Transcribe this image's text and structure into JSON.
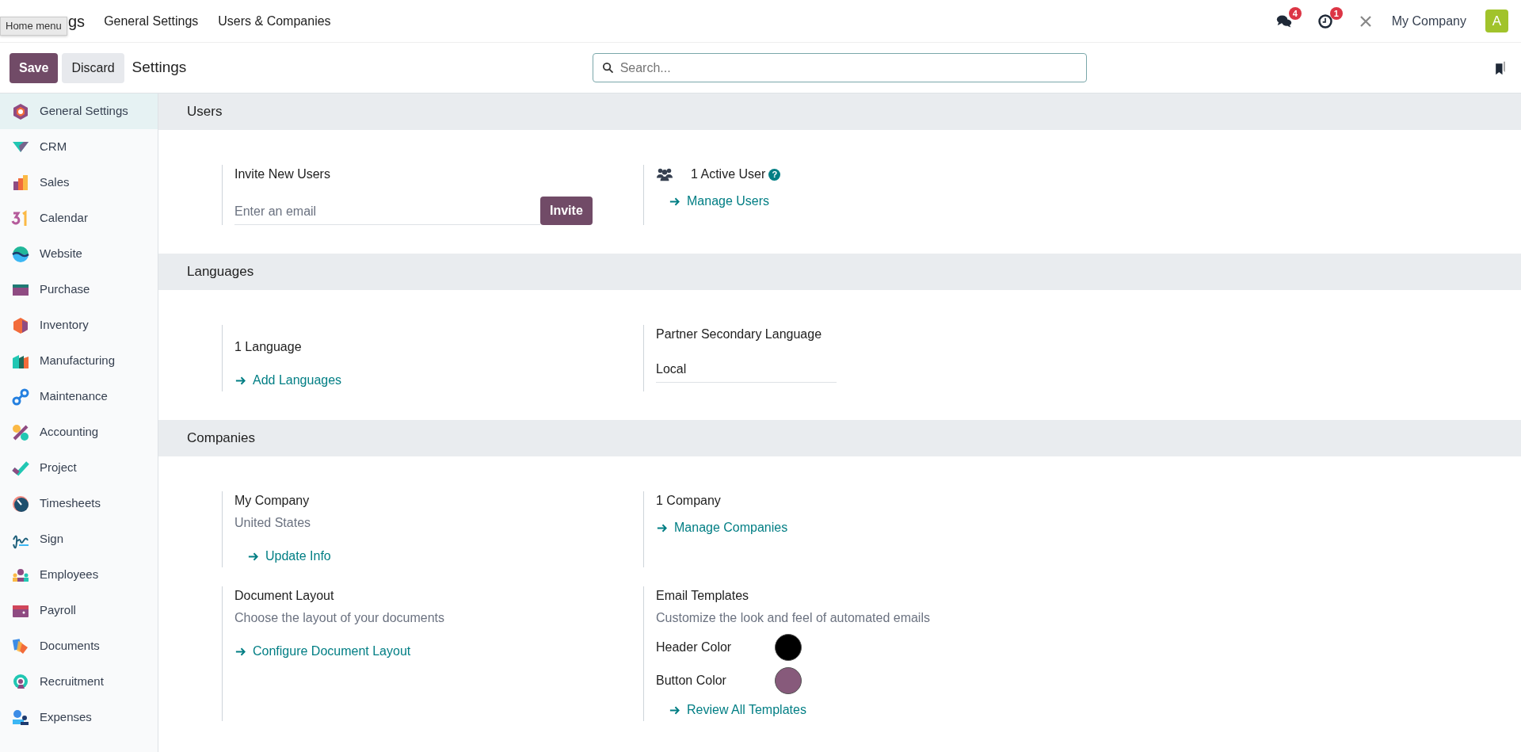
{
  "navbar": {
    "app_name": "gs",
    "tooltip": "Home menu",
    "menus": [
      "General Settings",
      "Users & Companies"
    ],
    "messages_badge": "4",
    "activities_badge": "1",
    "company": "My Company",
    "avatar": "A"
  },
  "control_panel": {
    "buttons": [
      {
        "label": "Save",
        "kind": "primary"
      },
      {
        "label": "Discard",
        "kind": "secondary"
      }
    ],
    "breadcrumb": "Settings",
    "search": {
      "placeholder": "Search..."
    }
  },
  "sidebar": {
    "items": [
      {
        "label": "General Settings",
        "selected": true
      },
      {
        "label": "CRM",
        "selected": false
      },
      {
        "label": "Sales",
        "selected": false
      },
      {
        "label": "Calendar",
        "selected": false
      },
      {
        "label": "Website",
        "selected": false
      },
      {
        "label": "Purchase",
        "selected": false
      },
      {
        "label": "Inventory",
        "selected": false
      },
      {
        "label": "Manufacturing",
        "selected": false
      },
      {
        "label": "Maintenance",
        "selected": false
      },
      {
        "label": "Accounting",
        "selected": false
      },
      {
        "label": "Project",
        "selected": false
      },
      {
        "label": "Timesheets",
        "selected": false
      },
      {
        "label": "Sign",
        "selected": false
      },
      {
        "label": "Employees",
        "selected": false
      },
      {
        "label": "Payroll",
        "selected": false
      },
      {
        "label": "Documents",
        "selected": false
      },
      {
        "label": "Recruitment",
        "selected": false
      },
      {
        "label": "Expenses",
        "selected": false
      }
    ]
  },
  "sections": [
    {
      "title": "Users",
      "settings": [
        {
          "title": "Invite New Users",
          "field": {
            "placeholder": "Enter an email"
          },
          "button": "Invite"
        },
        {
          "title": "1 Active User",
          "users_icon": true,
          "help": "?",
          "links": [
            "Manage Users"
          ]
        }
      ]
    },
    {
      "title": "Languages",
      "settings": [
        {
          "title": "1 Language",
          "links": [
            "Add Languages"
          ],
          "offset": true
        },
        {
          "title": "Partner Secondary Language",
          "field": {
            "value": "Local"
          }
        }
      ]
    },
    {
      "title": "Companies",
      "settings": [
        {
          "title": "My Company",
          "description": "United States",
          "links": [
            "Update Info"
          ],
          "indent_links": true
        },
        {
          "title": "1 Company",
          "links": [
            "Manage Companies"
          ]
        },
        {
          "title": "Document Layout",
          "description": "Choose the layout of your documents",
          "links": [
            "Configure Document Layout"
          ]
        },
        {
          "title": "Email Templates",
          "description": "Customize the look and feel of automated emails",
          "colors": [
            {
              "label": "Header Color",
              "color": "#000000"
            },
            {
              "label": "Button Color",
              "color": "#875a7b"
            }
          ],
          "links": [
            "Review All Templates"
          ],
          "indent_links": true
        }
      ]
    }
  ]
}
